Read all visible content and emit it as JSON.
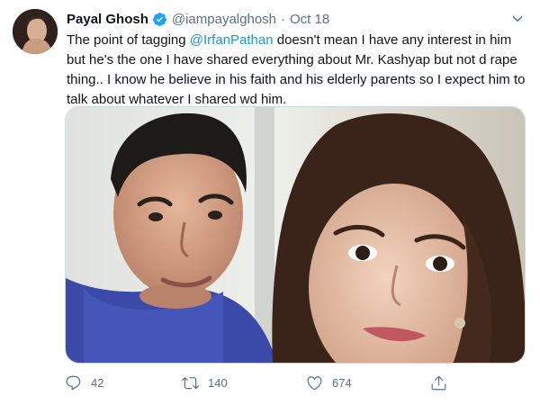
{
  "tweet": {
    "author_name": "Payal Ghosh",
    "handle": "@iampayalghosh",
    "separator": "·",
    "date": "Oct 18",
    "text_lines": [
      [
        "The point of tagging ",
        "@IrfanPathan",
        " doesn't mean I have any interest in him"
      ],
      "but he's the one I have shared everything about Mr. Kashyap but not d  rape",
      "thing.. I know he believe in his faith and his elderly parents so I expect him to",
      "talk about whatever I shared wd him."
    ],
    "mention": "@IrfanPathan",
    "replies": "42",
    "retweets": "140",
    "likes": "674"
  },
  "icons": {
    "verified": "verified-badge-icon",
    "caret": "chevron-down-icon",
    "reply": "reply-icon",
    "retweet": "retweet-icon",
    "like": "heart-icon",
    "share": "share-icon"
  },
  "colors": {
    "accent": "#1b95e0",
    "secondary_text": "#5b7083",
    "primary_text": "#0f1419"
  }
}
